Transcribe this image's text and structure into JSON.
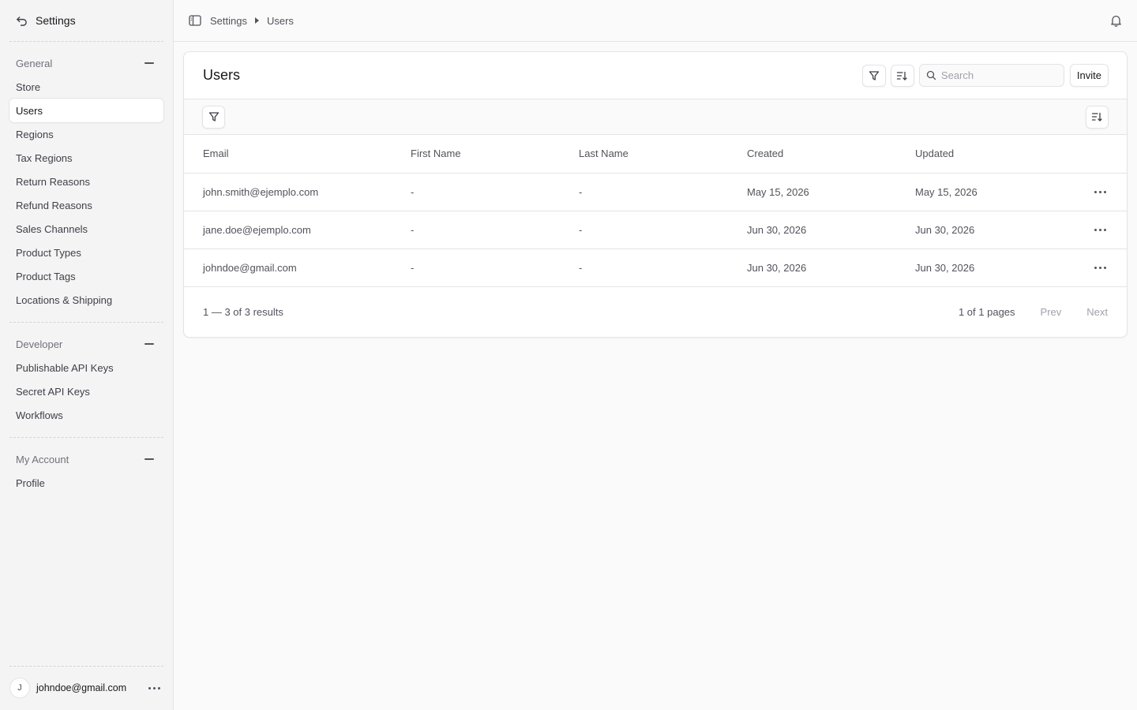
{
  "sidebar": {
    "title": "Settings",
    "sections": [
      {
        "label": "General",
        "items": [
          "Store",
          "Users",
          "Regions",
          "Tax Regions",
          "Return Reasons",
          "Refund Reasons",
          "Sales Channels",
          "Product Types",
          "Product Tags",
          "Locations & Shipping"
        ]
      },
      {
        "label": "Developer",
        "items": [
          "Publishable API Keys",
          "Secret API Keys",
          "Workflows"
        ]
      },
      {
        "label": "My Account",
        "items": [
          "Profile"
        ]
      }
    ],
    "active_item": "Users",
    "user": {
      "initial": "J",
      "email": "johndoe@gmail.com"
    }
  },
  "breadcrumb": [
    "Settings",
    "Users"
  ],
  "page": {
    "title": "Users",
    "search_placeholder": "Search",
    "invite_label": "Invite"
  },
  "table": {
    "columns": [
      "Email",
      "First Name",
      "Last Name",
      "Created",
      "Updated"
    ],
    "rows": [
      [
        "john.smith@ejemplo.com",
        "-",
        "-",
        "May 15, 2026",
        "May 15, 2026"
      ],
      [
        "jane.doe@ejemplo.com",
        "-",
        "-",
        "Jun 30, 2026",
        "Jun 30, 2026"
      ],
      [
        "johndoe@gmail.com",
        "-",
        "-",
        "Jun 30, 2026",
        "Jun 30, 2026"
      ]
    ]
  },
  "pagination": {
    "results": "1 — 3 of 3 results",
    "pages": "1 of 1 pages",
    "prev": "Prev",
    "next": "Next"
  }
}
